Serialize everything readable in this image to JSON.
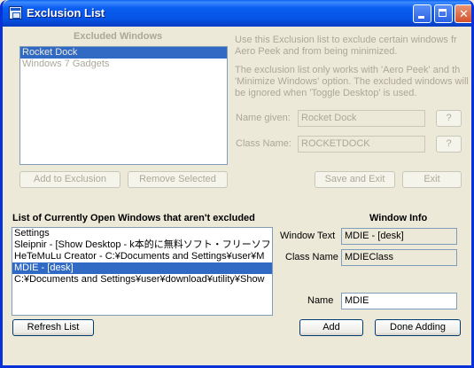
{
  "window": {
    "title": "Exclusion List"
  },
  "excluded": {
    "heading": "Excluded Windows",
    "items": [
      "Rocket Dock",
      "Windows 7 Gadgets"
    ],
    "add_button": "Add to Exclusion",
    "remove_button": "Remove Selected"
  },
  "description": {
    "line1": "Use this Exclusion list  to exclude certain windows fr",
    "line2": "Aero Peek and from being minimized.",
    "line3": "The exclusion list only works with 'Aero Peek' and th",
    "line4": "'Minimize Windows' option. The excluded windows will",
    "line5": "be ignored when 'Toggle Desktop' is used."
  },
  "details": {
    "name_label": "Name given:",
    "name_value": "Rocket Dock",
    "class_label": "Class Name:",
    "class_value": "ROCKETDOCK",
    "help_label": "?",
    "save_button": "Save and Exit",
    "exit_button": "Exit"
  },
  "open_windows": {
    "heading": "List of Currently Open Windows that aren't excluded",
    "items": [
      "Settings",
      "Sleipnir - [Show Desktop - k本的に無料ソフト・フリーソフト]",
      "HeTeMuLu Creator - C:¥Documents and Settings¥user¥M",
      "MDIE - [desk]",
      "C:¥Documents and Settings¥user¥download¥utility¥Show"
    ],
    "refresh_button": "Refresh List"
  },
  "window_info": {
    "heading": "Window Info",
    "text_label": "Window Text",
    "text_value": "MDIE - [desk]",
    "class_label": "Class Name",
    "class_value": "MDIEClass",
    "name_label": "Name",
    "name_value": "MDIE",
    "add_button": "Add",
    "done_button": "Done Adding"
  }
}
